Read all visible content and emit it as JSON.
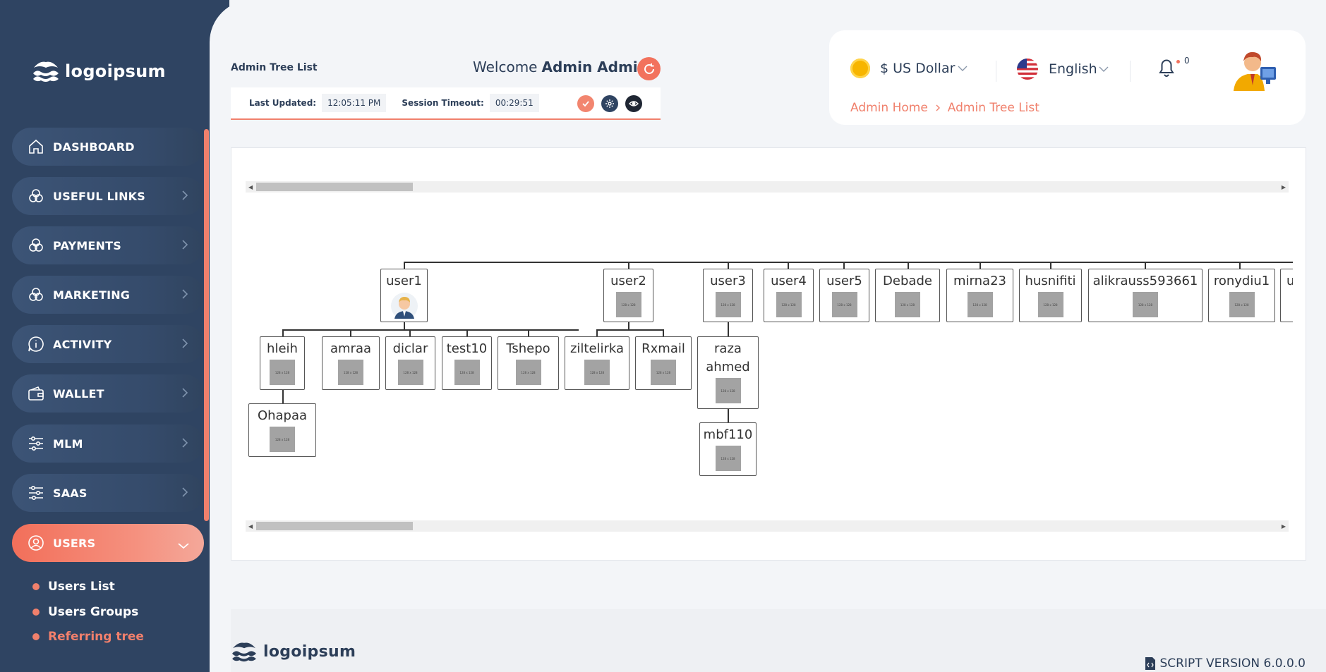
{
  "brand": {
    "logo_text": "logoipsum"
  },
  "sidebar": {
    "items": [
      {
        "label": "DASHBOARD",
        "icon": "home-icon"
      },
      {
        "label": "USEFUL LINKS",
        "icon": "links-icon"
      },
      {
        "label": "PAYMENTS",
        "icon": "payments-icon"
      },
      {
        "label": "MARKETING",
        "icon": "marketing-icon"
      },
      {
        "label": "ACTIVITY",
        "icon": "info-icon"
      },
      {
        "label": "WALLET",
        "icon": "wallet-icon"
      },
      {
        "label": "MLM",
        "icon": "sliders-icon"
      },
      {
        "label": "SAAS",
        "icon": "sliders-icon"
      },
      {
        "label": "USERS",
        "icon": "users-icon"
      }
    ],
    "sub_items": [
      {
        "label": "Users List"
      },
      {
        "label": "Users Groups"
      },
      {
        "label": "Referring tree"
      }
    ]
  },
  "header": {
    "page_title": "Admin Tree List",
    "welcome_prefix": "Welcome",
    "welcome_name": "Admin Admin",
    "last_updated_label": "Last Updated:",
    "last_updated_value": "12:05:11 PM",
    "session_label": "Session Timeout:",
    "session_value": "00:29:51"
  },
  "top_right": {
    "currency": "$ US Dollar",
    "language": "English",
    "notification_count": "0",
    "breadcrumb": [
      "Admin Home",
      "Admin Tree List"
    ]
  },
  "tree": {
    "placeholder_text": "128 x 128",
    "nodes": {
      "user1": "user1",
      "user2": "user2",
      "user3": "user3",
      "user4": "user4",
      "user5": "user5",
      "debade": "Debade",
      "mirna23": "mirna23",
      "husnifiti": "husnifiti",
      "alikrauss": "alikrauss593661",
      "ronydiu1": "ronydiu1",
      "partial": "u",
      "hleih": "hleih",
      "amraa": "amraa",
      "diclar": "diclar",
      "test10": "test10",
      "tshepo": "Tshepo",
      "ziltelirka": "ziltelirka",
      "rxmail": "Rxmail",
      "raza": "raza ahmed",
      "ohapaa": "Ohapaa",
      "mbf110": "mbf110"
    }
  },
  "footer": {
    "logo_text": "logoipsum",
    "version": "SCRIPT VERSION 6.0.0.0"
  },
  "colors": {
    "sidebar_bg": "#2f4462",
    "accent": "#f2725d",
    "text_dark": "#2c3e58"
  }
}
